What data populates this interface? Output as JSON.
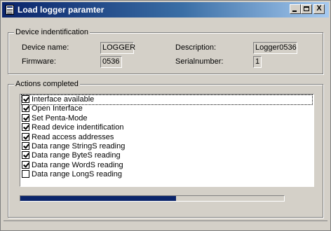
{
  "window": {
    "title": "Load logger paramter",
    "icon": "document-icon",
    "controls": {
      "minimize": "_",
      "maximize": "□",
      "close": "X"
    }
  },
  "device_group": {
    "legend": "Device indentification",
    "device_name_label": "Device name:",
    "device_name_value": "LOGGER",
    "firmware_label": "Firmware:",
    "firmware_value": "0536",
    "description_label": "Description:",
    "description_value": "Logger0536",
    "serial_label": "Serialnumber:",
    "serial_value": "1"
  },
  "actions_group": {
    "legend": "Actions completed",
    "items": [
      {
        "label": "Interface available",
        "checked": true
      },
      {
        "label": "Open Interface",
        "checked": true
      },
      {
        "label": "Set Penta-Mode",
        "checked": true
      },
      {
        "label": "Read device indentification",
        "checked": true
      },
      {
        "label": "Read access addresses",
        "checked": true
      },
      {
        "label": "Data range StringS reading",
        "checked": true
      },
      {
        "label": "Data range ByteS reading",
        "checked": true
      },
      {
        "label": "Data range WordS reading",
        "checked": true
      },
      {
        "label": "Data range LongS reading",
        "checked": false
      }
    ],
    "progress_fraction": 0.59
  }
}
